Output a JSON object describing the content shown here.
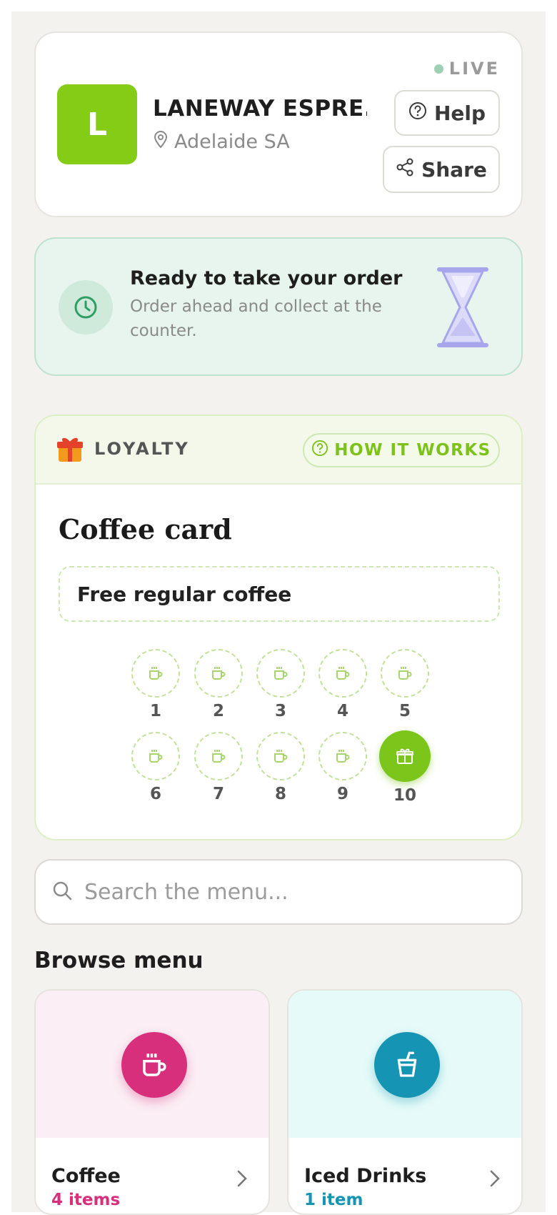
{
  "header": {
    "logo_letter": "L",
    "store_name": "LANEWAY ESPRE...",
    "location": "Adelaide SA",
    "status": "LIVE",
    "help_label": "Help",
    "share_label": "Share"
  },
  "banner": {
    "title": "Ready to take your order",
    "subtitle": "Order ahead and collect at the counter."
  },
  "loyalty": {
    "label": "LOYALTY",
    "how_label": "HOW IT WORKS",
    "card_title": "Coffee card",
    "reward": "Free regular coffee",
    "stamps": [
      "1",
      "2",
      "3",
      "4",
      "5",
      "6",
      "7",
      "8",
      "9",
      "10"
    ],
    "stamps_collected": 0
  },
  "search": {
    "placeholder": "Search the menu..."
  },
  "browse": {
    "title": "Browse menu",
    "categories": [
      {
        "name": "Coffee",
        "count": "4 items",
        "color": "#d72f7c",
        "bg": "#fbeef4"
      },
      {
        "name": "Iced Drinks",
        "count": "1 item",
        "color": "#1594b3",
        "bg": "#e6fbf9"
      }
    ]
  },
  "colors": {
    "accent": "#84cc16",
    "background": "#f4f2ee",
    "ready_bg": "#e7f5ee"
  }
}
